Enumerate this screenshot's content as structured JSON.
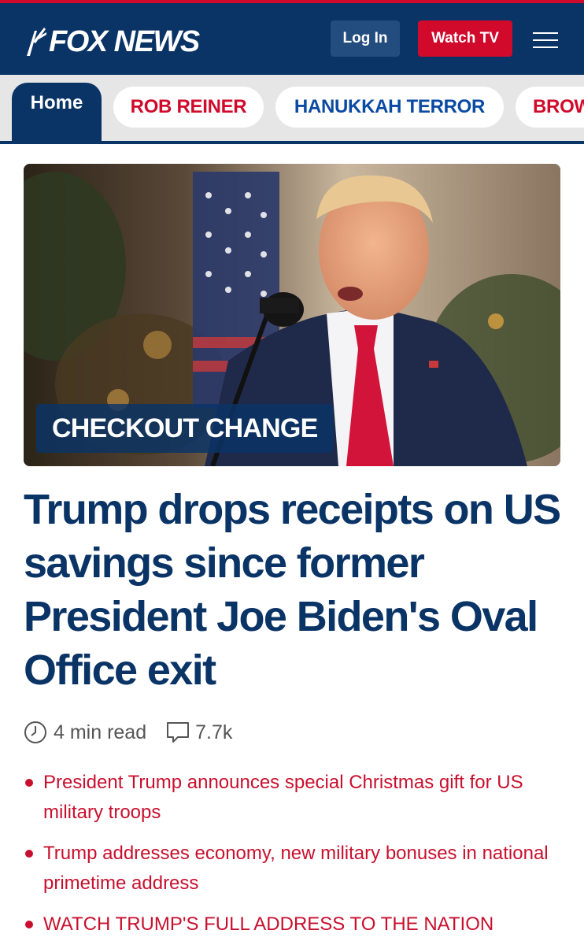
{
  "header": {
    "logo_text": "FOX NEWS",
    "login_label": "Log In",
    "watch_label": "Watch TV",
    "menu_icon": "hamburger-icon"
  },
  "nav": {
    "items": [
      {
        "label": "Home",
        "active": true
      },
      {
        "label": "ROB REINER"
      },
      {
        "label": "HANUKKAH TERROR"
      },
      {
        "label": "BROW"
      }
    ]
  },
  "hero": {
    "badge": "CHECKOUT CHANGE"
  },
  "article": {
    "headline": "Trump drops receipts on US savings since former President Joe Biden's Oval Office exit",
    "read_time": "4 min read",
    "comment_count": "7.7k"
  },
  "related": [
    {
      "text": "President Trump announces special Christmas gift for US military troops"
    },
    {
      "text": "Trump addresses economy, new military bonuses in national primetime address"
    },
    {
      "text": "WATCH TRUMP'S FULL ADDRESS TO THE NATION"
    }
  ],
  "colors": {
    "brand_navy": "#0a3366",
    "brand_red": "#d10a2c",
    "link_red": "#c8102e"
  }
}
